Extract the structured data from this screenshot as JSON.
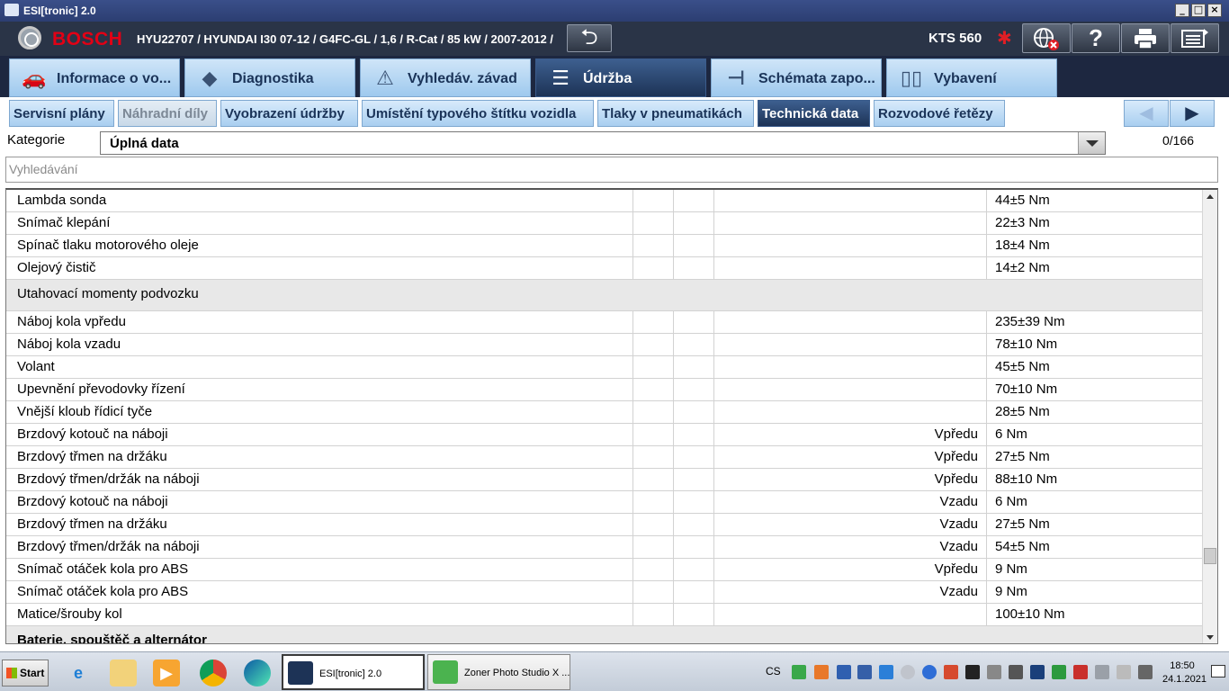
{
  "window": {
    "title": "ESI[tronic] 2.0",
    "min": "_",
    "max": "□",
    "close": "×"
  },
  "header": {
    "brand": "BOSCH",
    "vehicle": "HYU22707 / HYUNDAI I30 07-12 / G4FC-GL / 1,6 / R-Cat / 85 kW / 2007-2012 /",
    "device": "KTS 560",
    "help_glyph": "?",
    "bt_glyph": "✱"
  },
  "main_tabs": [
    {
      "label": "Informace o vo...",
      "icon": "car-info-icon",
      "glyph": "🚗"
    },
    {
      "label": "Diagnostika",
      "icon": "diagnostics-plug-icon",
      "glyph": "◆"
    },
    {
      "label": "Vyhledáv. závad",
      "icon": "search-fault-icon",
      "glyph": "⚠"
    },
    {
      "label": "Údržba",
      "icon": "maintenance-icon",
      "glyph": "☰",
      "active": true
    },
    {
      "label": "Schémata zapo...",
      "icon": "wiring-diagram-icon",
      "glyph": "⊣"
    },
    {
      "label": "Vybavení",
      "icon": "book-icon",
      "glyph": "▯▯"
    }
  ],
  "sub_tabs": [
    {
      "label": "Servisní plány"
    },
    {
      "label": "Náhradní díly",
      "disabled": true
    },
    {
      "label": "Vyobrazení údržby"
    },
    {
      "label": "Umístění typového štítku vozidla"
    },
    {
      "label": "Tlaky v pneumatikách"
    },
    {
      "label": "Technická data",
      "active": true
    },
    {
      "label": "Rozvodové řetězy"
    }
  ],
  "nav": {
    "prev": "◀",
    "next": "▶"
  },
  "category": {
    "label": "Kategorie",
    "value": "Úplná data",
    "counter": "0/166"
  },
  "search": {
    "placeholder": "Vyhledávání"
  },
  "rows": [
    {
      "name": "Lambda sonda",
      "pos": "",
      "value": "44±5 Nm"
    },
    {
      "name": "Snímač klepání",
      "pos": "",
      "value": "22±3 Nm"
    },
    {
      "name": "Spínač tlaku motorového oleje",
      "pos": "",
      "value": "18±4 Nm"
    },
    {
      "name": "Olejový čistič",
      "pos": "",
      "value": "14±2 Nm"
    },
    {
      "name": "Utahovací momenty podvozku",
      "pos": "",
      "value": "",
      "section": true
    },
    {
      "name": "Náboj kola vpředu",
      "pos": "",
      "value": "235±39 Nm"
    },
    {
      "name": "Náboj kola vzadu",
      "pos": "",
      "value": "78±10 Nm"
    },
    {
      "name": "Volant",
      "pos": "",
      "value": "45±5 Nm"
    },
    {
      "name": "Upevnění převodovky řízení",
      "pos": "",
      "value": "70±10 Nm"
    },
    {
      "name": "Vnější kloub řídicí tyče",
      "pos": "",
      "value": "28±5 Nm"
    },
    {
      "name": "Brzdový kotouč na náboji",
      "pos": "Vpředu",
      "value": "6 Nm"
    },
    {
      "name": "Brzdový třmen na držáku",
      "pos": "Vpředu",
      "value": "27±5 Nm"
    },
    {
      "name": "Brzdový třmen/držák na náboji",
      "pos": "Vpředu",
      "value": "88±10 Nm"
    },
    {
      "name": "Brzdový kotouč na náboji",
      "pos": "Vzadu",
      "value": "6 Nm"
    },
    {
      "name": "Brzdový třmen na držáku",
      "pos": "Vzadu",
      "value": "27±5 Nm"
    },
    {
      "name": "Brzdový třmen/držák na náboji",
      "pos": "Vzadu",
      "value": "54±5 Nm"
    },
    {
      "name": "Snímač otáček kola pro ABS",
      "pos": "Vpředu",
      "value": "9 Nm"
    },
    {
      "name": "Snímač otáček kola pro ABS",
      "pos": "Vzadu",
      "value": "9 Nm"
    },
    {
      "name": "Matice/šrouby kol",
      "pos": "",
      "value": "100±10 Nm"
    },
    {
      "name": "Baterie, spouštěč a alternátor",
      "pos": "",
      "value": "",
      "section": true,
      "bold": true
    }
  ],
  "taskbar": {
    "start": "Start",
    "tasks": [
      {
        "label": "ESI[tronic] 2.0",
        "active": true
      },
      {
        "label": "Zoner Photo Studio X ..."
      }
    ],
    "lang": "CS",
    "time": "18:50",
    "date": "24.1.2021",
    "colors": {
      "accent": "#1d3356",
      "brand": "#e20015"
    }
  }
}
